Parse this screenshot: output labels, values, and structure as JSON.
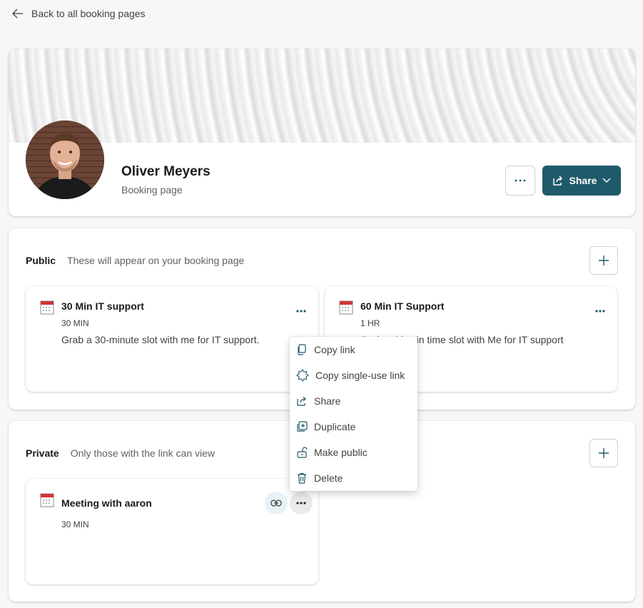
{
  "nav": {
    "back_label": "Back to all booking pages"
  },
  "profile": {
    "name": "Oliver Meyers",
    "subtitle": "Booking page",
    "share_label": "Share"
  },
  "public_section": {
    "label": "Public",
    "description": "These will appear on your booking page",
    "services": [
      {
        "title": "30 Min IT support",
        "duration": "30 MIN",
        "description": "Grab a 30-minute slot with me for IT support."
      },
      {
        "title": "60 Min IT Support",
        "duration": "1 HR",
        "description": "Grab a 60-min time slot with Me for IT support"
      }
    ]
  },
  "private_section": {
    "label": "Private",
    "description": "Only those with the link can view",
    "services": [
      {
        "title": "Meeting with aaron",
        "duration": "30 MIN"
      }
    ]
  },
  "context_menu": {
    "items": [
      {
        "label": "Copy link",
        "icon": "copy-icon"
      },
      {
        "label": "Copy single-use link",
        "icon": "badge-icon"
      },
      {
        "label": "Share",
        "icon": "share-icon"
      },
      {
        "label": "Duplicate",
        "icon": "duplicate-icon"
      },
      {
        "label": "Make public",
        "icon": "unlock-icon"
      },
      {
        "label": "Delete",
        "icon": "trash-icon"
      }
    ]
  },
  "colors": {
    "accent": "#1f5a6b",
    "calendar_red": "#d13438"
  }
}
